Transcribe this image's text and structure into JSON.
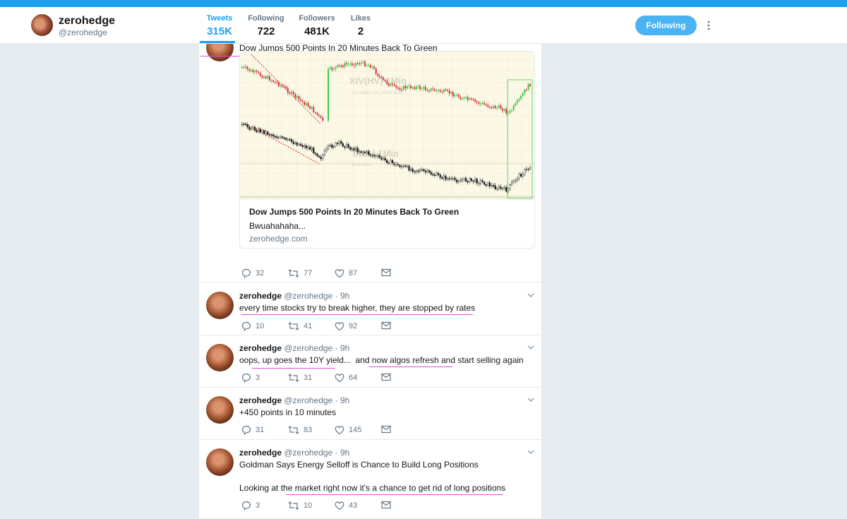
{
  "profile": {
    "name": "zerohedge",
    "handle": "@zerohedge",
    "follow_button": "Following",
    "stats": [
      {
        "label": "Tweets",
        "value": "315K"
      },
      {
        "label": "Following",
        "value": "722"
      },
      {
        "label": "Followers",
        "value": "481K"
      },
      {
        "label": "Likes",
        "value": "2"
      }
    ]
  },
  "tweets": [
    {
      "text": "Dow Jumps 500 Points In 20 Minutes Back To Green",
      "card": {
        "chart_label_top": "XIV(HV) 1Min",
        "chart_sublabel_top": "VS Inverse VIX Short Term",
        "chart_label_bottom": "INDU 1Min",
        "chart_sublabel_bottom": "Dow Jones",
        "title": "Dow Jumps 500 Points In 20 Minutes Back To Green",
        "description": "Bwuahahaha...",
        "url": "zerohedge.com"
      },
      "replies": "32",
      "retweets": "77",
      "likes": "87"
    },
    {
      "name": "zerohedge",
      "handle": "@zerohedge",
      "time": "· 9h",
      "text": "every time stocks try to break higher, they are stopped by rates",
      "replies": "10",
      "retweets": "41",
      "likes": "92"
    },
    {
      "name": "zerohedge",
      "handle": "@zerohedge",
      "time": "· 9h",
      "text": "oops, up goes the 10Y yield...  and now algos refresh and start selling again",
      "replies": "3",
      "retweets": "31",
      "likes": "64"
    },
    {
      "name": "zerohedge",
      "handle": "@zerohedge",
      "time": "· 9h",
      "text": "+450 points in 10 minutes",
      "replies": "31",
      "retweets": "83",
      "likes": "145"
    },
    {
      "name": "zerohedge",
      "handle": "@zerohedge",
      "time": "· 9h",
      "text": "Goldman Says Energy Selloff is Chance to Build Long Positions",
      "text2": "Looking at the market right now it's a chance to get rid of long positions",
      "replies": "3",
      "retweets": "10",
      "likes": "43"
    }
  ],
  "colors": {
    "accent": "#1da1f2",
    "follow_button": "#4ab3f4",
    "annotation_underline": "#e84fd3",
    "candle_up": "#2ec43a",
    "candle_down": "#d2232a"
  }
}
